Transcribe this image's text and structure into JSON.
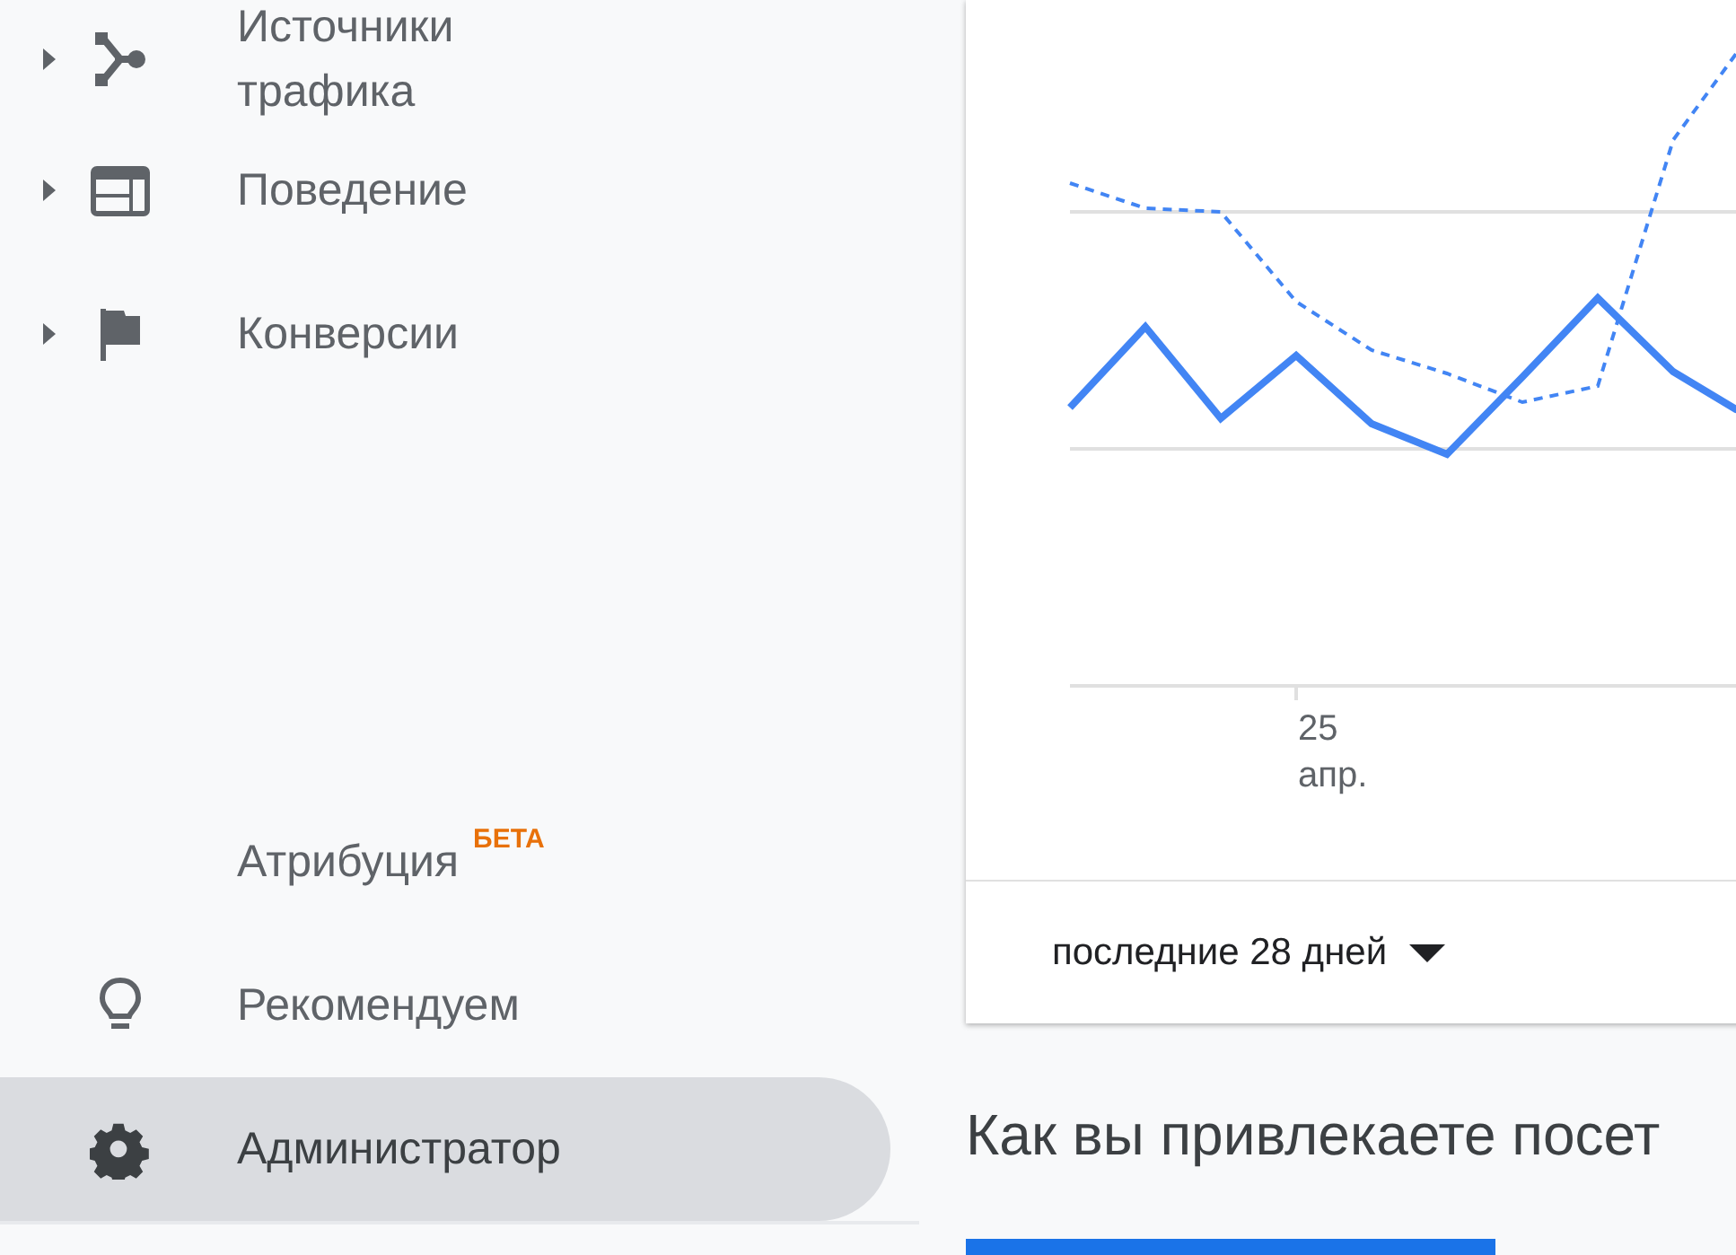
{
  "sidebar": {
    "items": [
      {
        "label": "Источники трафика",
        "expandable": true,
        "selected": false
      },
      {
        "label": "Поведение",
        "expandable": true,
        "selected": false
      },
      {
        "label": "Конверсии",
        "expandable": true,
        "selected": false
      }
    ],
    "bottom_items": [
      {
        "label": "Атрибуция",
        "expandable": false,
        "selected": false,
        "beta": "БЕТА"
      },
      {
        "label": "Рекомендуем",
        "expandable": false,
        "selected": false
      },
      {
        "label": "Администратор",
        "expandable": false,
        "selected": true
      }
    ]
  },
  "chart_card": {
    "x_tick": {
      "day": "25",
      "month": "апр."
    },
    "period": "последние 28 дней"
  },
  "section_heading": "Как вы привлекаете посет"
}
